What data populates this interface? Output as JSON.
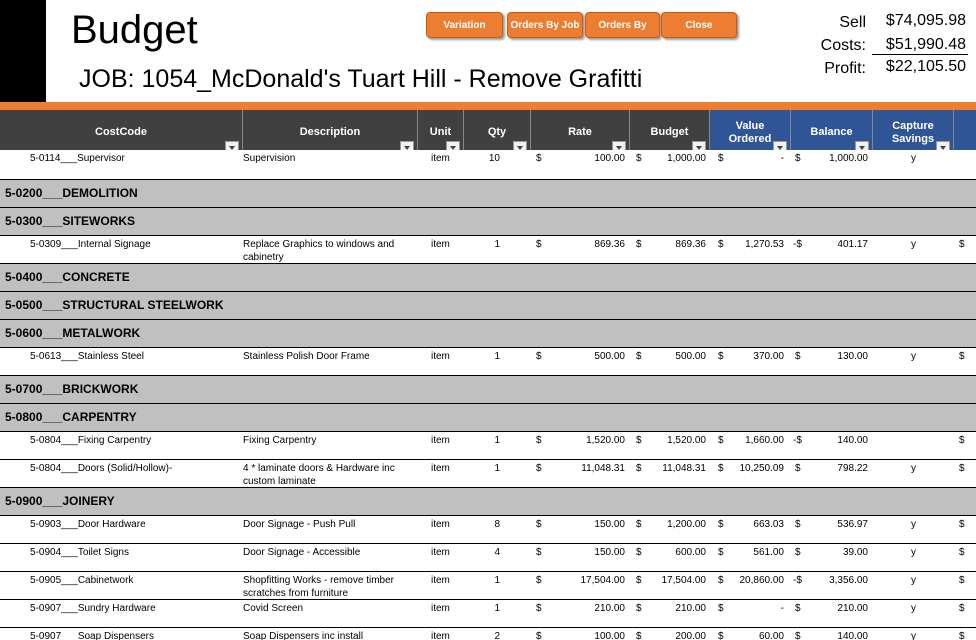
{
  "title": "Budget",
  "job": "JOB: 1054_McDonald's Tuart Hill - Remove Grafitti",
  "buttons": [
    {
      "label": "Variation"
    },
    {
      "label": "Orders By Job"
    },
    {
      "label": "Orders By"
    },
    {
      "label": "Close"
    }
  ],
  "summary": {
    "sell_label": "Sell",
    "sell_value": "$74,095.98",
    "costs_label": "Costs:",
    "costs_value": "$51,990.48",
    "profit_label": "Profit:",
    "profit_value": "$22,105.50"
  },
  "columns": [
    "CostCode",
    "Description",
    "Unit",
    "Qty",
    "Rate",
    "Budget",
    "Value Ordered",
    "Balance",
    "Capture Savings"
  ],
  "partial_top_row": {
    "code": "5-0114___Supervisor",
    "desc": "Supervision",
    "unit": "item",
    "qty": "10",
    "rate_cur": "$",
    "rate": "100.00",
    "budget_cur": "$",
    "budget": "1,000.00",
    "value_cur": "$",
    "value": "-",
    "bal_cur": "$",
    "balance": "1,000.00",
    "cap": "y"
  },
  "rows": [
    {
      "type": "section",
      "label": "5-0200___DEMOLITION"
    },
    {
      "type": "section",
      "label": "5-0300___SITEWORKS"
    },
    {
      "type": "item",
      "code": "5-0309___Internal Signage",
      "desc": "Replace Graphics to windows and",
      "desc2": "cabinetry",
      "unit": "item",
      "qty": "1",
      "rate_cur": "$",
      "rate": "869.36",
      "budget_cur": "$",
      "budget": "869.36",
      "value_cur": "$",
      "value": "1,270.53",
      "bal_cur": "-$",
      "balance": "401.17",
      "cap": "y",
      "end": "$"
    },
    {
      "type": "section",
      "label": "5-0400___CONCRETE"
    },
    {
      "type": "section",
      "label": "5-0500___STRUCTURAL STEELWORK"
    },
    {
      "type": "section",
      "label": "5-0600___METALWORK"
    },
    {
      "type": "item",
      "code": "5-0613___Stainless Steel",
      "desc": "Stainless Polish Door Frame",
      "desc2": "",
      "unit": "item",
      "qty": "1",
      "rate_cur": "$",
      "rate": "500.00",
      "budget_cur": "$",
      "budget": "500.00",
      "value_cur": "$",
      "value": "370.00",
      "bal_cur": "$",
      "balance": "130.00",
      "cap": "y",
      "end": "$"
    },
    {
      "type": "section",
      "label": "5-0700___BRICKWORK"
    },
    {
      "type": "section",
      "label": "5-0800___CARPENTRY"
    },
    {
      "type": "item",
      "code": "5-0804___Fixing Carpentry",
      "desc": "Fixing Carpentry",
      "desc2": "",
      "unit": "item",
      "qty": "1",
      "rate_cur": "$",
      "rate": "1,520.00",
      "budget_cur": "$",
      "budget": "1,520.00",
      "value_cur": "$",
      "value": "1,660.00",
      "bal_cur": "-$",
      "balance": "140.00",
      "cap": "",
      "end": "$"
    },
    {
      "type": "item",
      "code": "5-0804___Doors (Solid/Hollow)-",
      "desc": "4 * laminate doors & Hardware inc",
      "desc2": "custom laminate",
      "unit": "item",
      "qty": "1",
      "rate_cur": "$",
      "rate": "11,048.31",
      "budget_cur": "$",
      "budget": "11,048.31",
      "value_cur": "$",
      "value": "10,250.09",
      "bal_cur": "$",
      "balance": "798.22",
      "cap": "y",
      "end": "$"
    },
    {
      "type": "section",
      "label": "5-0900___JOINERY"
    },
    {
      "type": "item",
      "code": "5-0903___Door Hardware",
      "desc": "Door Signage - Push Pull",
      "desc2": "",
      "unit": "item",
      "qty": "8",
      "rate_cur": "$",
      "rate": "150.00",
      "budget_cur": "$",
      "budget": "1,200.00",
      "value_cur": "$",
      "value": "663.03",
      "bal_cur": "$",
      "balance": "536.97",
      "cap": "y",
      "end": "$"
    },
    {
      "type": "item",
      "code": "5-0904___Toilet Signs",
      "desc": "Door Signage - Accessible",
      "desc2": "",
      "unit": "item",
      "qty": "4",
      "rate_cur": "$",
      "rate": "150.00",
      "budget_cur": "$",
      "budget": "600.00",
      "value_cur": "$",
      "value": "561.00",
      "bal_cur": "$",
      "balance": "39.00",
      "cap": "y",
      "end": "$"
    },
    {
      "type": "item",
      "code": "5-0905___Cabinetwork",
      "desc": "Shopfitting Works - remove timber",
      "desc2": "scratches from furniture",
      "unit": "item",
      "qty": "1",
      "rate_cur": "$",
      "rate": "17,504.00",
      "budget_cur": "$",
      "budget": "17,504.00",
      "value_cur": "$",
      "value": "20,860.00",
      "bal_cur": "-$",
      "balance": "3,356.00",
      "cap": "y",
      "end": "$"
    },
    {
      "type": "item",
      "code": "5-0907___Sundry Hardware",
      "desc": "Covid Screen",
      "desc2": "",
      "unit": "item",
      "qty": "1",
      "rate_cur": "$",
      "rate": "210.00",
      "budget_cur": "$",
      "budget": "210.00",
      "value_cur": "$",
      "value": "-",
      "bal_cur": "$",
      "balance": "210.00",
      "cap": "y",
      "end": "$"
    },
    {
      "type": "item",
      "code": "5-0907___Soap Dispensers",
      "desc": "Soap Dispensers inc install",
      "desc2": "",
      "unit": "item",
      "qty": "2",
      "rate_cur": "$",
      "rate": "100.00",
      "budget_cur": "$",
      "budget": "200.00",
      "value_cur": "$",
      "value": "60.00",
      "bal_cur": "$",
      "balance": "140.00",
      "cap": "y",
      "end": "$"
    }
  ]
}
